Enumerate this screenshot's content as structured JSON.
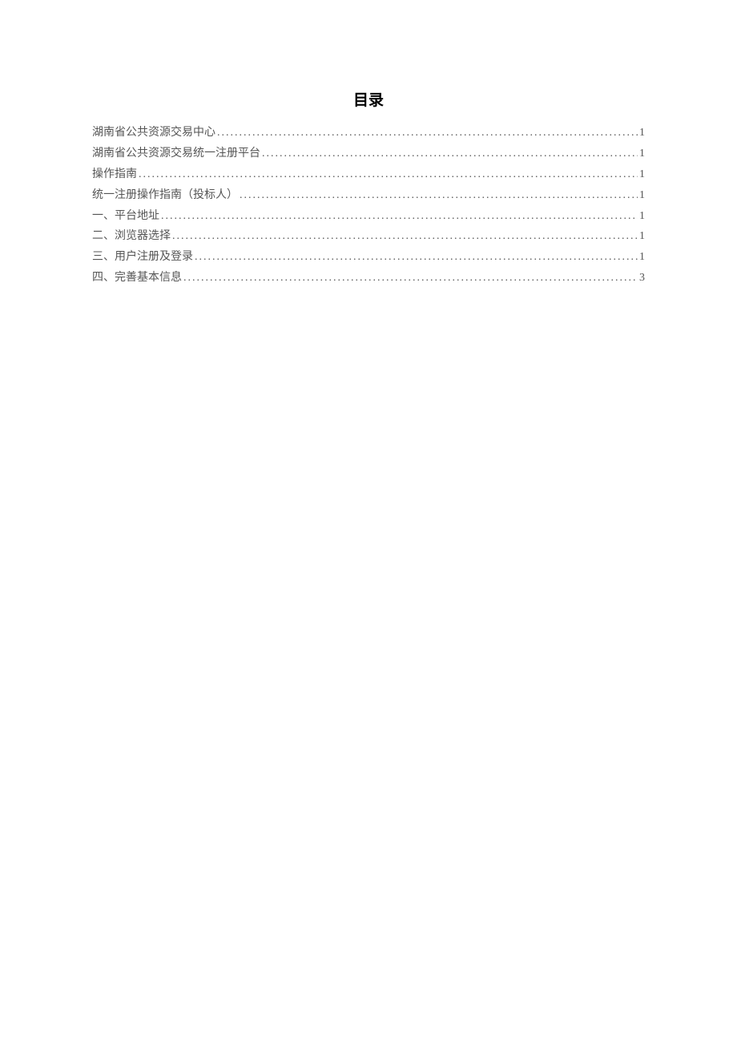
{
  "title": "目录",
  "entries": [
    {
      "text": "湖南省公共资源交易中心",
      "page": "1"
    },
    {
      "text": "湖南省公共资源交易统一注册平台",
      "page": "1"
    },
    {
      "text": "操作指南",
      "page": "1"
    },
    {
      "text": "统一注册操作指南（投标人）",
      "page": "1"
    },
    {
      "text": "一、平台地址",
      "page": "1"
    },
    {
      "text": "二、浏览器选择",
      "page": "1"
    },
    {
      "text": "三、用户注册及登录",
      "page": "1"
    },
    {
      "text": "四、完善基本信息",
      "page": "3"
    }
  ]
}
